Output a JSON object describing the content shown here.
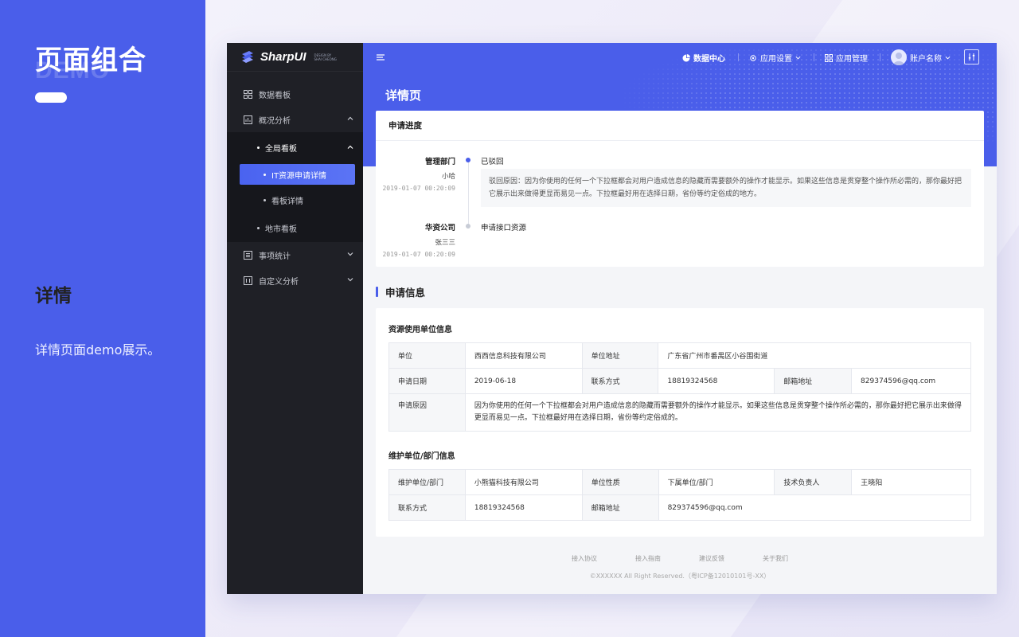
{
  "promo": {
    "title": "页面组合",
    "ghost": "DEMO",
    "section": "详情",
    "description": "详情页面demo展示。"
  },
  "brand": {
    "logo_text": "SharpUI",
    "logo_small_1": "DESIGN BY",
    "logo_small_2": "SHAI CHEONG"
  },
  "sidebar": {
    "items": [
      {
        "label": "数据看板",
        "icon": "grid-icon"
      },
      {
        "label": "概况分析",
        "icon": "chart-icon"
      },
      {
        "label": "全局看板"
      },
      {
        "label": "IT资源申请详情"
      },
      {
        "label": "看板详情"
      },
      {
        "label": "地市看板"
      },
      {
        "label": "事项统计",
        "icon": "list-icon"
      },
      {
        "label": "自定义分析",
        "icon": "custom-icon"
      }
    ]
  },
  "topbar": {
    "data_center": "数据中心",
    "app_settings": "应用设置",
    "app_manage": "应用管理",
    "account": "账户名称"
  },
  "page": {
    "title": "详情页"
  },
  "progress": {
    "title": "申请进度",
    "steps": [
      {
        "dept": "管理部门",
        "person": "小哈",
        "time": "2019-01-07 00:20:09",
        "status": "已驳回",
        "reason": "驳回原因：因为你使用的任何一个下拉框都会对用户造成信息的隐藏而需要额外的操作才能显示。如果这些信息是贯穿整个操作所必需的，那你最好把它展示出来做得更显而易见一点。下拉框最好用在选择日期，省份等约定俗成的地方。"
      },
      {
        "dept": "华资公司",
        "person": "张三三",
        "time": "2019-01-07 00:20:09",
        "status": "申请接口资源"
      }
    ]
  },
  "info": {
    "section_title": "申请信息",
    "unit_title": "资源使用单位信息",
    "unit": {
      "k_unit": "单位",
      "v_unit": "西西信息科技有限公司",
      "k_addr": "单位地址",
      "v_addr": "广东省广州市番禺区小谷围街道",
      "k_date": "申请日期",
      "v_date": "2019-06-18",
      "k_contact": "联系方式",
      "v_contact": "18819324568",
      "k_email": "邮箱地址",
      "v_email": "829374596@qq.com",
      "k_reason": "申请原因",
      "v_reason": "因为你使用的任何一个下拉框都会对用户造成信息的隐藏而需要额外的操作才能显示。如果这些信息是贯穿整个操作所必需的，那你最好把它展示出来做得更显而易见一点。下拉框最好用在选择日期，省份等约定俗成的。"
    },
    "maint_title": "维护单位/部门信息",
    "maint": {
      "k_unit": "维护单位/部门",
      "v_unit": "小熊猫科技有限公司",
      "k_type": "单位性质",
      "v_type": "下属单位/部门",
      "k_lead": "技术负责人",
      "v_lead": "王晓阳",
      "k_contact": "联系方式",
      "v_contact": "18819324568",
      "k_email": "邮箱地址",
      "v_email": "829374596@qq.com"
    }
  },
  "footer": {
    "links": [
      "接入协议",
      "接入指南",
      "建议反馈",
      "关于我们"
    ],
    "copyright": "©XXXXXX All Right Reserved.（粤ICP备12010101号-XX）"
  },
  "colors": {
    "primary": "#4a5eea",
    "sidebar_bg": "#1f2026",
    "active_item": "#4a63f0"
  }
}
